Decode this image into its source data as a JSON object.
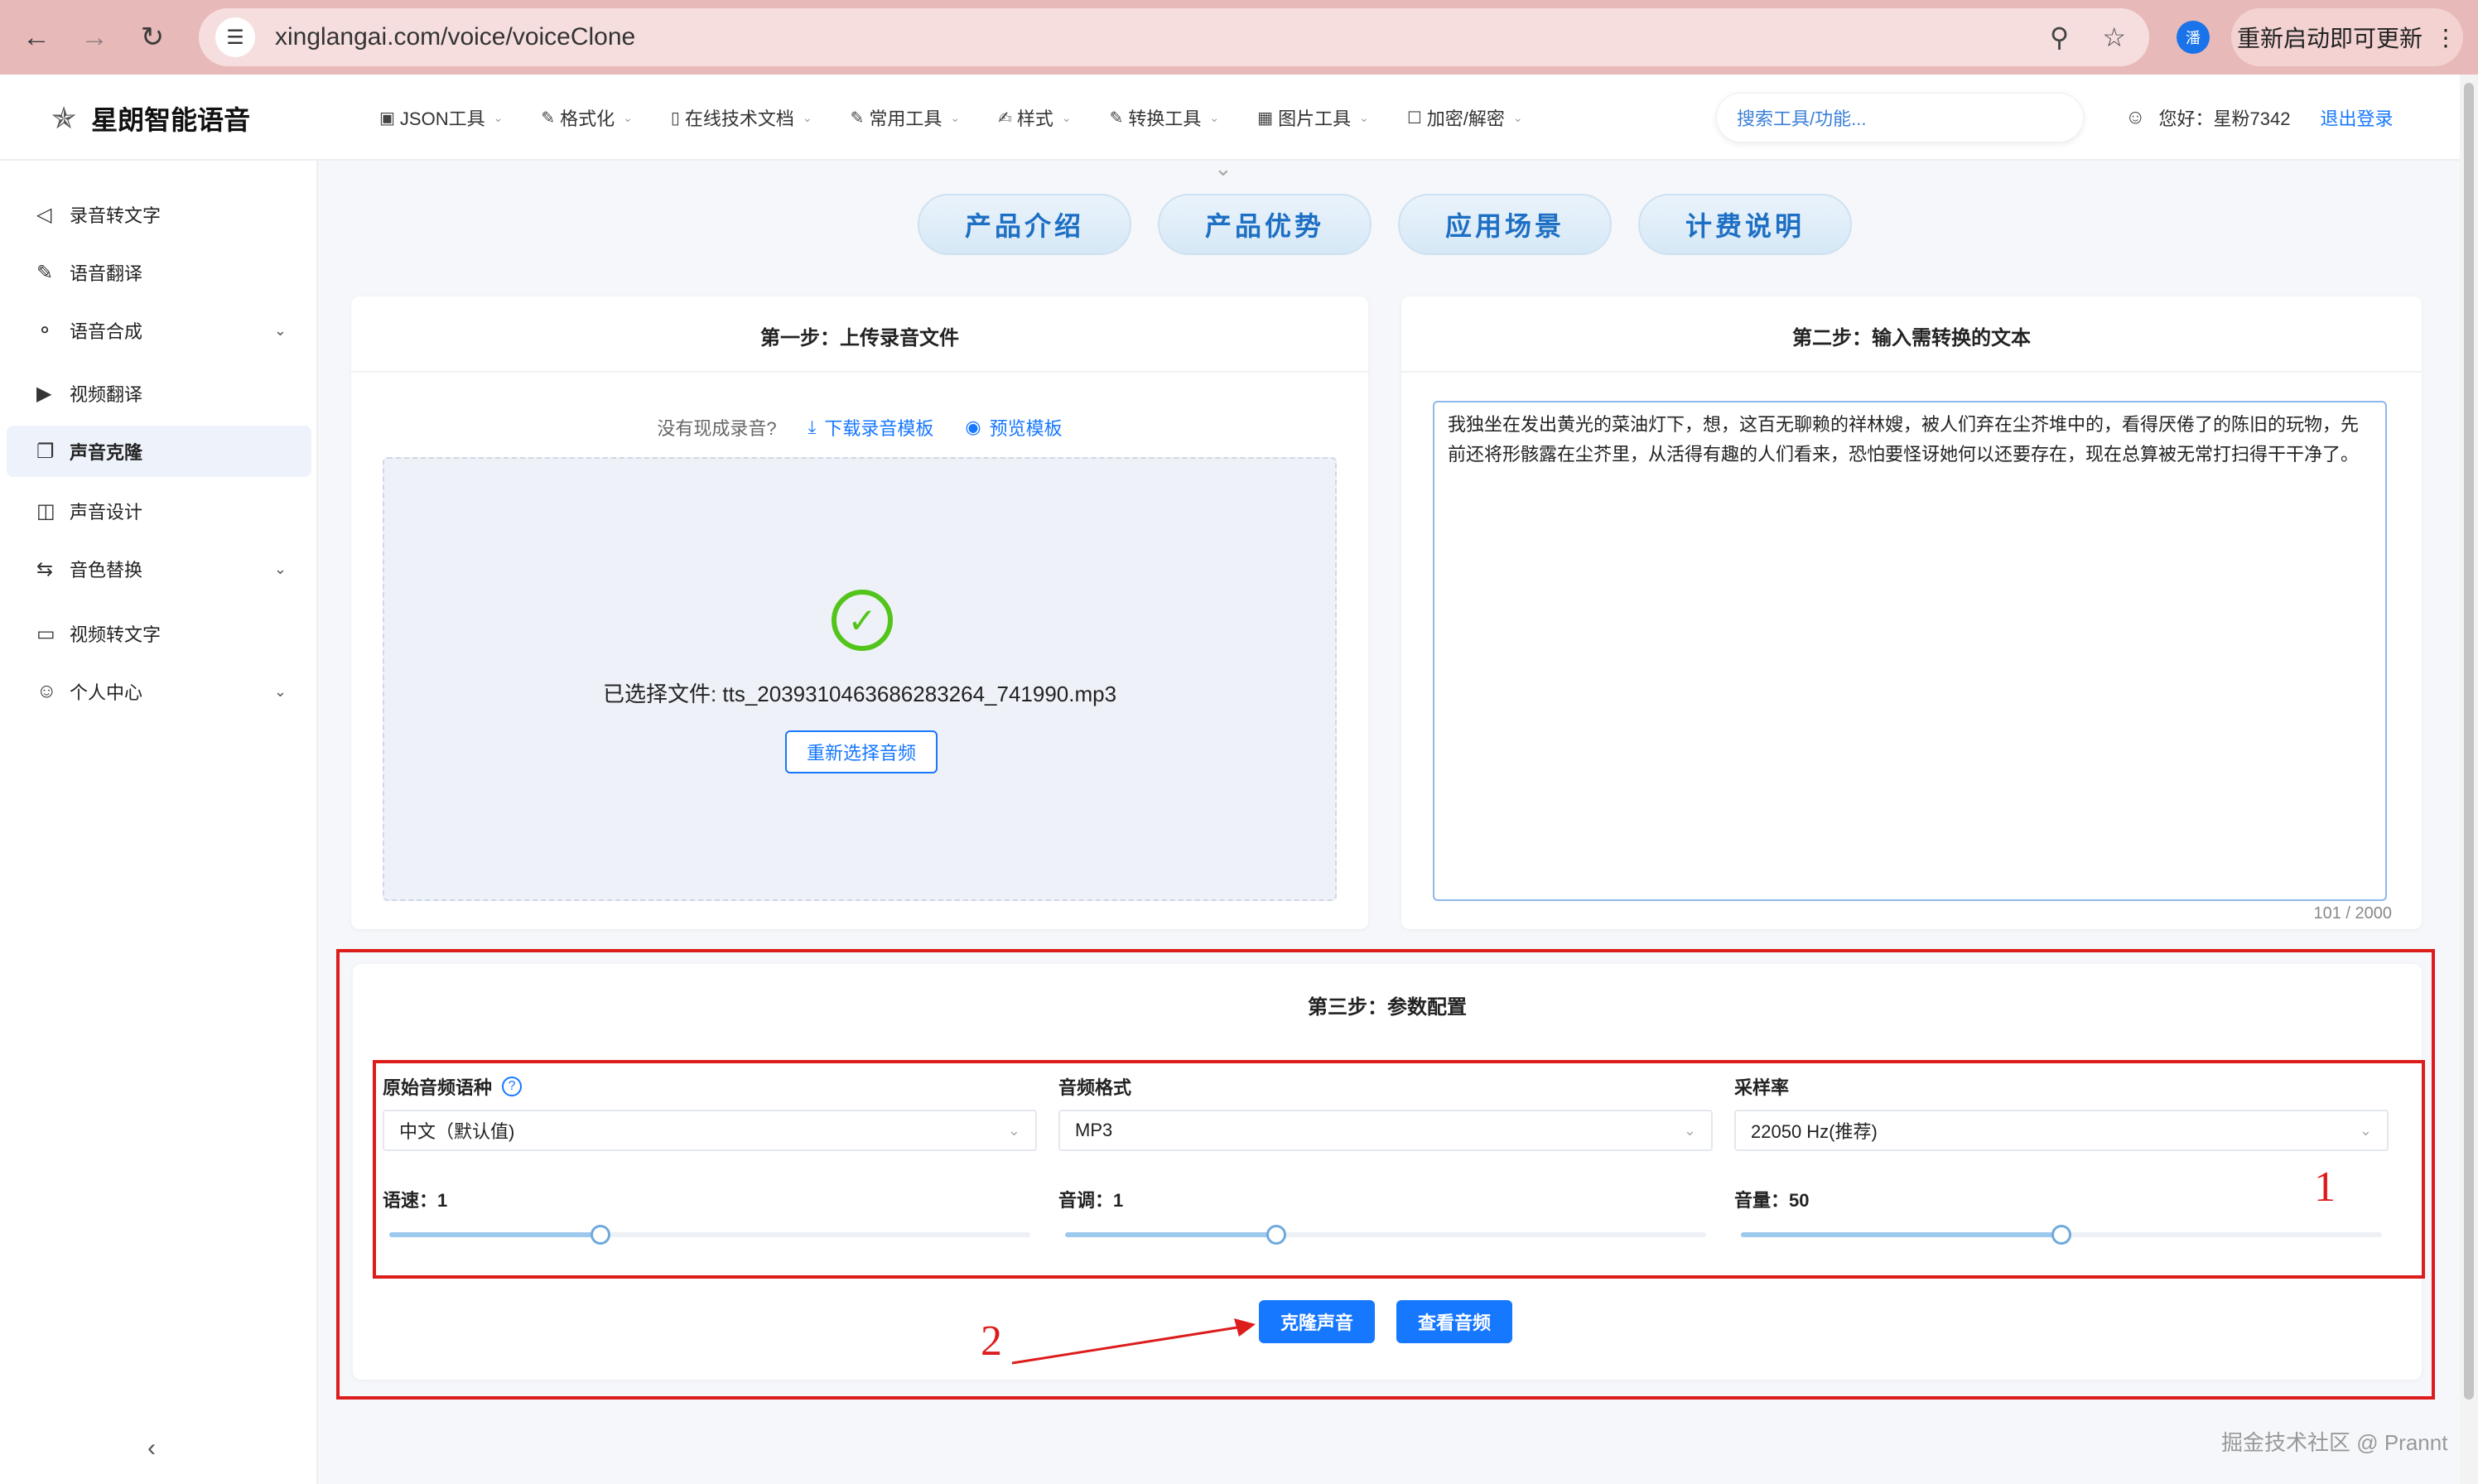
{
  "browser": {
    "url": "xinglangai.com/voice/voiceClone",
    "update_label": "重新启动即可更新",
    "profile_initial": "潘"
  },
  "header": {
    "brand": "星朗智能语音",
    "nav": [
      {
        "label": "JSON工具",
        "icon": "code-icon"
      },
      {
        "label": "格式化",
        "icon": "edit-icon"
      },
      {
        "label": "在线技术文档",
        "icon": "document-icon"
      },
      {
        "label": "常用工具",
        "icon": "edit-icon"
      },
      {
        "label": "样式",
        "icon": "brush-icon"
      },
      {
        "label": "转换工具",
        "icon": "edit-icon"
      },
      {
        "label": "图片工具",
        "icon": "image-icon"
      },
      {
        "label": "加密/解密",
        "icon": "lock-icon"
      }
    ],
    "search_placeholder": "搜索工具/功能...",
    "greeting": "您好：星粉7342",
    "logout": "退出登录"
  },
  "sidebar": {
    "items": [
      {
        "label": "录音转文字",
        "icon": "speaker-icon"
      },
      {
        "label": "语音翻译",
        "icon": "translate-icon"
      },
      {
        "label": "语音合成",
        "icon": "microphone-icon"
      },
      {
        "label": "视频翻译",
        "icon": "video-play-icon"
      },
      {
        "label": "声音克隆",
        "icon": "copy-icon"
      },
      {
        "label": "声音设计",
        "icon": "design-icon"
      },
      {
        "label": "音色替换",
        "icon": "swap-icon"
      },
      {
        "label": "视频转文字",
        "icon": "video-icon"
      },
      {
        "label": "个人中心",
        "icon": "user-icon"
      }
    ],
    "active_index": 4
  },
  "tabs": [
    "产品介绍",
    "产品优势",
    "应用场景",
    "计费说明"
  ],
  "step1": {
    "title": "第一步：上传录音文件",
    "no_recording": "没有现成录音?",
    "download_template": "下载录音模板",
    "preview_template": "预览模板",
    "selected_file": "已选择文件: tts_2039310463686283264_741990.mp3",
    "reselect": "重新选择音频"
  },
  "step2": {
    "title": "第二步：输入需转换的文本",
    "text": "我独坐在发出黄光的菜油灯下，想，这百无聊赖的祥林嫂，被人们弃在尘芥堆中的，看得厌倦了的陈旧的玩物，先前还将形骸露在尘芥里，从活得有趣的人们看来，恐怕要怪讶她何以还要存在，现在总算被无常打扫得干干净了。",
    "counter": "101 / 2000"
  },
  "step3": {
    "title": "第三步：参数配置",
    "source_lang_label": "原始音频语种",
    "source_lang_value": "中文（默认值)",
    "format_label": "音频格式",
    "format_value": "MP3",
    "sample_rate_label": "采样率",
    "sample_rate_value": "22050 Hz(推荐)",
    "speed_label": "语速：1",
    "speed_level": 0.33,
    "pitch_label": "音调：1",
    "pitch_level": 0.33,
    "volume_label": "音量：50",
    "volume_level": 0.5,
    "clone_button": "克隆声音",
    "view_button": "查看音频"
  },
  "annotations": {
    "marker1": "1",
    "marker2": "2"
  },
  "watermark": "掘金技术社区 @ Prannt",
  "colors": {
    "primary": "#1677ff",
    "annotation": "#dd1c1c",
    "success": "#52c41a"
  }
}
